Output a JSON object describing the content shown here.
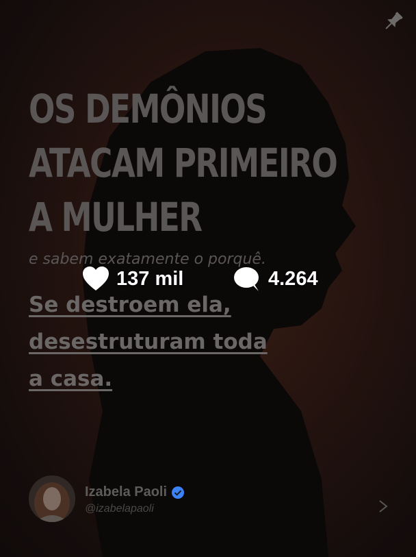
{
  "post": {
    "headline": [
      "OS DEMÔNIOS",
      "ATACAM PRIMEIRO",
      "A MULHER"
    ],
    "subtitle": "e sabem exatamente o porquê.",
    "statement": [
      "Se destroem ela,",
      "desestruturam toda",
      "a casa."
    ]
  },
  "stats": {
    "likes": "137 mil",
    "comments": "4.264"
  },
  "author": {
    "name": "Izabela Paoli",
    "handle": "@izabelapaoli"
  },
  "icons": {
    "pin": "pin-icon",
    "like": "heart-icon",
    "comment": "comment-bubble-icon",
    "verified": "verified-badge-icon",
    "next": "arrow-right-icon"
  },
  "colors": {
    "background": "#1a1110",
    "headline": "#5a5656",
    "verified": "#3b82f6",
    "stats_text": "#ffffff"
  }
}
